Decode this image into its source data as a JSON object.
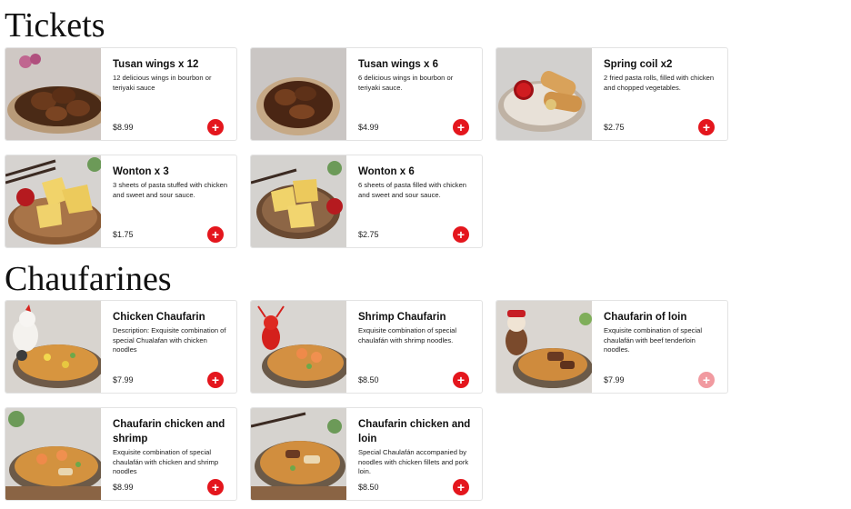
{
  "sections": [
    {
      "title": "Tickets",
      "items": [
        {
          "name": "Tusan wings x 12",
          "description": "12 delicious wings in bourbon or teriyaki sauce",
          "price": "$8.99",
          "add": "+",
          "image": "wings-plate-image"
        },
        {
          "name": "Tusan wings x 6",
          "description": "6 delicious wings in bourbon or teriyaki sauce.",
          "price": "$4.99",
          "add": "+",
          "image": "wings-plate-image"
        },
        {
          "name": "Spring coil x2",
          "description": "2 fried pasta rolls, filled with chicken and chopped vegetables.",
          "price": "$2.75",
          "add": "+",
          "image": "spring-rolls-image"
        },
        {
          "name": "Wonton x 3",
          "description": "3 sheets of pasta stuffed with chicken and sweet and sour sauce.",
          "price": "$1.75",
          "add": "+",
          "image": "wonton-plate-image"
        },
        {
          "name": "Wonton x 6",
          "description": "6 sheets of pasta filled with chicken and sweet and sour sauce.",
          "price": "$2.75",
          "add": "+",
          "image": "wonton-plate-image"
        }
      ]
    },
    {
      "title": "Chaufarines",
      "items": [
        {
          "name": "Chicken Chaufarin",
          "description": "Description: Exquisite combination of special Chualafan with chicken noodles",
          "price": "$7.99",
          "add": "+",
          "image": "chaufa-chicken-image"
        },
        {
          "name": "Shrimp Chaufarin",
          "description": "Exquisite combination of special chaulafán with shrimp noodles.",
          "price": "$8.50",
          "add": "+",
          "image": "chaufa-shrimp-image"
        },
        {
          "name": "Chaufarin of loin",
          "description": "Exquisite combination of special chaulafán with beef tenderloin noodles.",
          "price": "$7.99",
          "add": "+",
          "image": "chaufa-loin-image"
        },
        {
          "name": "Chaufarin chicken and shrimp",
          "description": "Exquisite combination of special chaulafán with chicken and shrimp noodles",
          "price": "$8.99",
          "add": "+",
          "image": "chaufa-chicken-shrimp-image"
        },
        {
          "name": "Chaufarin chicken and loin",
          "description": "Special Chaulafán accompanied by noodles with chicken fillets and pork loin.",
          "price": "$8.50",
          "add": "+",
          "image": "chaufa-chicken-loin-image"
        }
      ]
    }
  ],
  "colors": {
    "accent": "#e4161d",
    "accent_disabled": "#f19aa0",
    "card_border": "#e3e3e3"
  }
}
